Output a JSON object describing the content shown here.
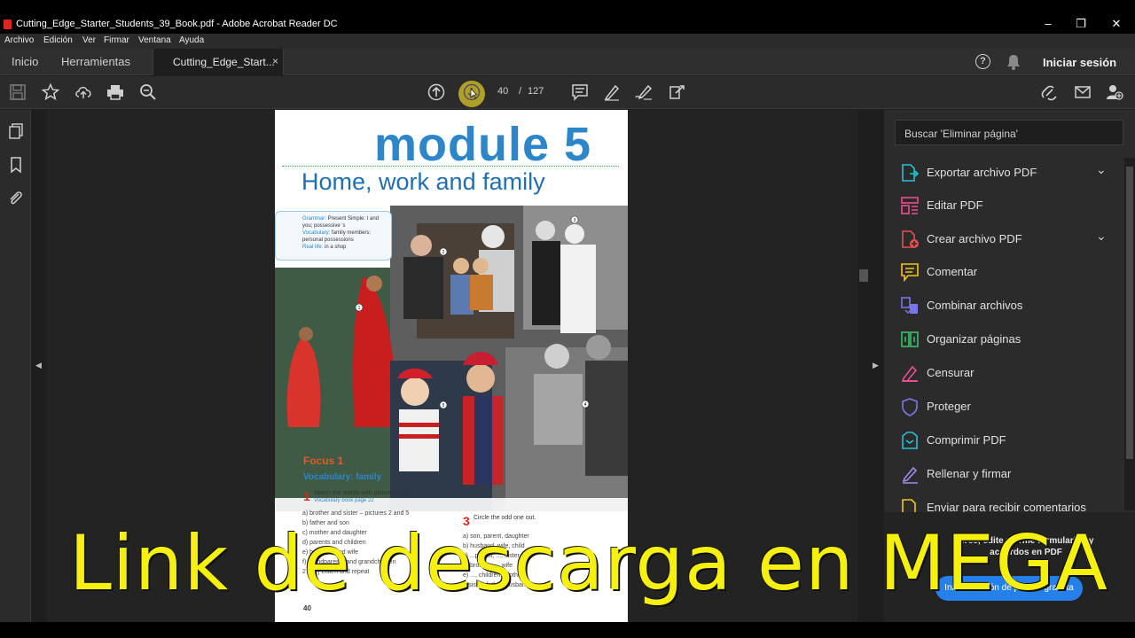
{
  "window": {
    "title": "Cutting_Edge_Starter_Students_39_Book.pdf - Adobe Acrobat Reader DC",
    "controls": [
      "–",
      "❐",
      "✕"
    ]
  },
  "menu": [
    "Archivo",
    "Edición",
    "Ver",
    "Firmar",
    "Ventana",
    "Ayuda"
  ],
  "tabs": {
    "home": "Inicio",
    "tools": "Herramientas",
    "document": "Cutting_Edge_Start...",
    "close": "×"
  },
  "account": {
    "help": "?",
    "signin": "Iniciar sesión"
  },
  "toolbar": {
    "icons": [
      "save-icon",
      "star-icon",
      "upload-icon",
      "print-icon",
      "zoom-icon",
      "page-up-icon",
      "page-down-icon",
      "comment-icon",
      "highlight-icon",
      "sign-icon",
      "fill-icon",
      "share-link-icon",
      "email-icon",
      "add-user-icon"
    ],
    "page_current": "40",
    "page_separator": "/",
    "page_total": "127"
  },
  "document": {
    "module_title": "module 5",
    "subtitle": "Home, work and family",
    "info_lines": [
      {
        "key": "Grammar:",
        "text": "Present Simple: I and you; possessive 's"
      },
      {
        "key": "Vocabulary:",
        "text": "family members; personal possessions"
      },
      {
        "key": "Real life:",
        "text": "in a shop"
      }
    ],
    "picture_numbers": [
      "1",
      "2",
      "3",
      "4",
      "5"
    ],
    "focus": "Focus 1",
    "vocab_heading": "Vocabulary: family",
    "ex1_number": "1",
    "ex1_text": "Match the words with pictures 1–5.",
    "ex1_ref": "Vocabulary book page 22",
    "ex1_items": [
      "a) brother and sister – pictures 2 and 5",
      "b) father and son",
      "c) mother and daughter",
      "d) parents and children",
      "e) husband and wife",
      "f) grandparents and grandchildren",
      "2 [5.1] Listen and repeat"
    ],
    "ex3_number": "3",
    "ex3_text": "Circle the odd one out.",
    "ex3_items": [
      "a) son, parent, daughter",
      "b) husband, wife, child",
      "c) ...parent, ..., sister",
      "d) brother, ..., wife",
      "e) ..., children, mother",
      "f) sister, father, husband"
    ],
    "page_number": "40"
  },
  "right_panel": {
    "search_placeholder": "Buscar 'Eliminar página'",
    "tools": [
      {
        "label": "Exportar archivo PDF",
        "icon": "export-pdf-icon",
        "color": "#26c0d8",
        "expand": "⌄"
      },
      {
        "label": "Editar PDF",
        "icon": "edit-pdf-icon",
        "color": "#e8508f",
        "expand": ""
      },
      {
        "label": "Crear archivo PDF",
        "icon": "create-pdf-icon",
        "color": "#e85050",
        "expand": "⌄"
      },
      {
        "label": "Comentar",
        "icon": "comment-icon",
        "color": "#f5c518",
        "expand": ""
      },
      {
        "label": "Combinar archivos",
        "icon": "combine-files-icon",
        "color": "#7b76e6",
        "expand": ""
      },
      {
        "label": "Organizar páginas",
        "icon": "organize-pages-icon",
        "color": "#3fbf6a",
        "expand": ""
      },
      {
        "label": "Censurar",
        "icon": "redact-icon",
        "color": "#e8508f",
        "expand": ""
      },
      {
        "label": "Proteger",
        "icon": "protect-shield-icon",
        "color": "#7b76e6",
        "expand": ""
      },
      {
        "label": "Comprimir PDF",
        "icon": "compress-pdf-icon",
        "color": "#26c0d8",
        "expand": ""
      },
      {
        "label": "Rellenar y firmar",
        "icon": "fill-sign-icon",
        "color": "#a38af0",
        "expand": ""
      },
      {
        "label": "Enviar para recibir comentarios",
        "icon": "send-review-icon",
        "color": "#f5c518",
        "expand": ""
      }
    ],
    "promo_text": "Cree, edite y firme formularios y acuerdos en PDF",
    "promo_button": "Iniciar versión de prueba gratuita"
  },
  "overlay_text": "Link de descarga en MEGA",
  "colors": {
    "accent_blue": "#2680eb",
    "overlay_yellow": "#f5f00e",
    "module_blue": "#2d86c8"
  }
}
